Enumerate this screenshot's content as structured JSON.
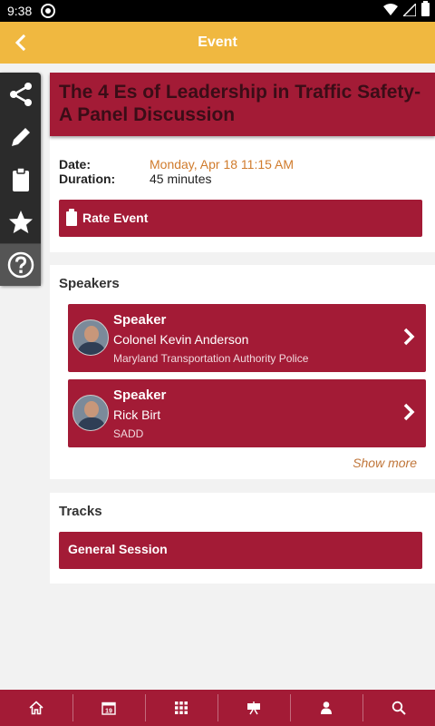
{
  "status_bar": {
    "time": "9:38"
  },
  "app_bar": {
    "title": "Event",
    "back_icon": "back-arrow-icon"
  },
  "side_toolbar": {
    "items": [
      {
        "icon": "share-icon"
      },
      {
        "icon": "pencil-icon"
      },
      {
        "icon": "clipboard-icon"
      },
      {
        "icon": "star-icon"
      },
      {
        "icon": "help-icon"
      }
    ]
  },
  "event": {
    "title": "The 4 Es of Leadership in Traffic Safety- A Panel Discussion",
    "date_label": "Date:",
    "date_value": "Monday, Apr 18 11:15 AM",
    "duration_label": "Duration:",
    "duration_value": "45 minutes",
    "rate_button": "Rate Event"
  },
  "speakers": {
    "heading": "Speakers",
    "items": [
      {
        "role": "Speaker",
        "name": "Colonel Kevin Anderson",
        "org": "Maryland Transportation Authority Police"
      },
      {
        "role": "Speaker",
        "name": "Rick Birt",
        "org": "SADD"
      }
    ],
    "show_more": "Show more"
  },
  "tracks": {
    "heading": "Tracks",
    "items": [
      {
        "label": "General Session"
      }
    ]
  },
  "bottom_nav": {
    "calendar_day": "19",
    "items": [
      {
        "icon": "home-icon"
      },
      {
        "icon": "calendar-icon"
      },
      {
        "icon": "grid-icon"
      },
      {
        "icon": "presentation-icon"
      },
      {
        "icon": "person-icon"
      },
      {
        "icon": "search-icon"
      }
    ]
  },
  "colors": {
    "accent": "#a31b36",
    "app_bar": "#f0b840",
    "link": "#d07b2c"
  }
}
